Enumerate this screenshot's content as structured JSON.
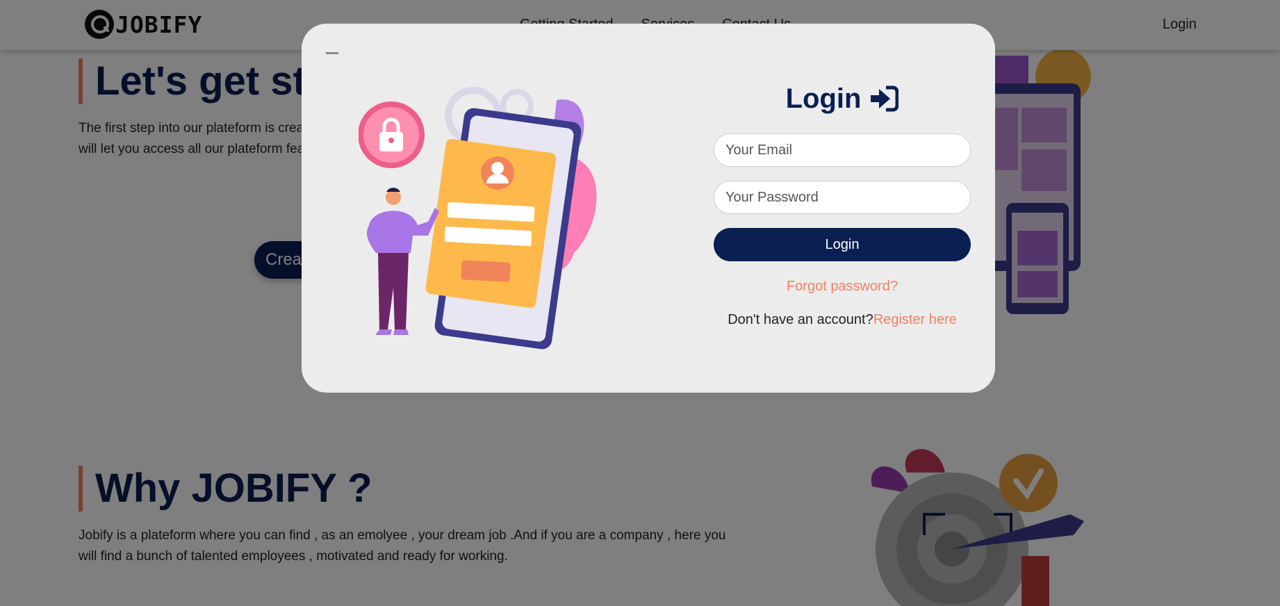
{
  "navbar": {
    "brand": "JOBIFY",
    "links": [
      "Getting Started",
      "Services",
      "Contact Us"
    ],
    "login": "Login"
  },
  "hero": {
    "title": "Let's get started !",
    "text": "The first step into our plateform is creating your own account. Whether you are a candidate or an employer, this will let you access all our plateform features and job offers !",
    "cta_label": "Create Account"
  },
  "why": {
    "title": "Why JOBIFY ?",
    "text": "Jobify is a plateform where you can find , as an emolyee , your dream job .And if you are a company , here you will find a bunch of talented employees , motivated and ready for working."
  },
  "modal": {
    "close_icon": "minus-icon",
    "title": "Login",
    "title_icon": "sign-in-icon",
    "email_placeholder": "Your Email",
    "password_placeholder": "Your Password",
    "submit_label": "Login",
    "forgot_label": "Forgot password?",
    "register_prompt": "Don't have an account?",
    "register_link": "Register here"
  },
  "colors": {
    "navy": "#0a1f52",
    "accent": "#f08163",
    "modal_bg": "#ececec",
    "backdrop": "rgba(0,0,0,0.5)"
  }
}
